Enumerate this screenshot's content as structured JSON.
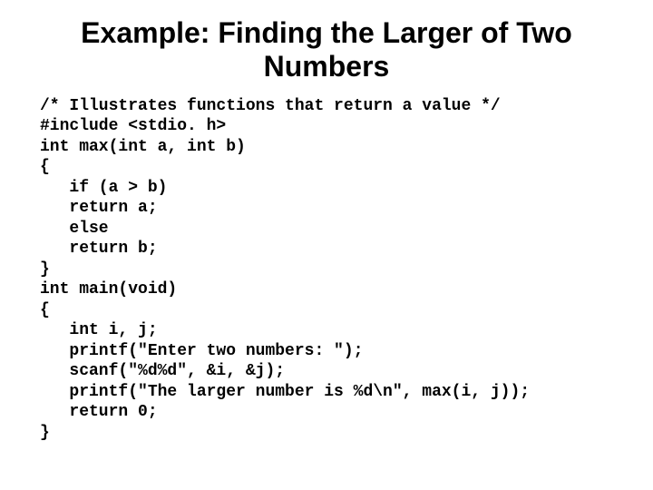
{
  "title": "Example: Finding the Larger of Two Numbers",
  "code": "/* Illustrates functions that return a value */\n#include <stdio. h>\nint max(int a, int b)\n{\n   if (a > b)\n   return a;\n   else\n   return b;\n}\nint main(void)\n{\n   int i, j;\n   printf(\"Enter two numbers: \");\n   scanf(\"%d%d\", &i, &j);\n   printf(\"The larger number is %d\\n\", max(i, j));\n   return 0;\n}"
}
